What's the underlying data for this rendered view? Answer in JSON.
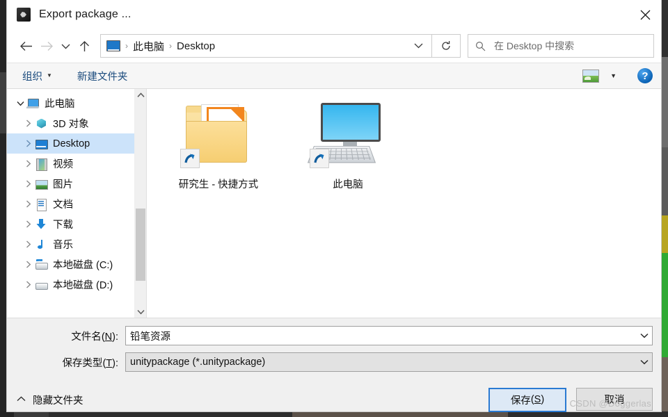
{
  "window": {
    "title": "Export package ...",
    "app_icon": "unity-icon",
    "close_label": "✕"
  },
  "nav": {
    "back_icon": "arrow-left-icon",
    "forward_icon": "arrow-right-icon",
    "recent_icon": "chevron-down-icon",
    "up_icon": "arrow-up-icon",
    "refresh_icon": "refresh-icon",
    "address_icon": "desktop-icon",
    "breadcrumbs": [
      "此电脑",
      "Desktop"
    ],
    "separator": "›",
    "dropdown_icon": "chevron-down-icon"
  },
  "search": {
    "icon": "search-icon",
    "placeholder": "在 Desktop 中搜索"
  },
  "toolbar": {
    "organize_label": "组织",
    "organize_caret": "▼",
    "new_folder_label": "新建文件夹",
    "view_icon": "view-layout-icon",
    "view_caret": "▼",
    "help_label": "?"
  },
  "sidebar": {
    "items": [
      {
        "label": "此电脑",
        "icon": "this-pc-icon",
        "level": 0,
        "expanded": true,
        "selected": false
      },
      {
        "label": "3D 对象",
        "icon": "3d-objects-icon",
        "level": 1,
        "expanded": false,
        "selected": false
      },
      {
        "label": "Desktop",
        "icon": "desktop-icon",
        "level": 1,
        "expanded": false,
        "selected": true
      },
      {
        "label": "视频",
        "icon": "videos-icon",
        "level": 1,
        "expanded": false,
        "selected": false
      },
      {
        "label": "图片",
        "icon": "pictures-icon",
        "level": 1,
        "expanded": false,
        "selected": false
      },
      {
        "label": "文档",
        "icon": "documents-icon",
        "level": 1,
        "expanded": false,
        "selected": false
      },
      {
        "label": "下载",
        "icon": "downloads-icon",
        "level": 1,
        "expanded": false,
        "selected": false
      },
      {
        "label": "音乐",
        "icon": "music-icon",
        "level": 1,
        "expanded": false,
        "selected": false
      },
      {
        "label": "本地磁盘 (C:)",
        "icon": "system-drive-icon",
        "level": 1,
        "expanded": false,
        "selected": false
      },
      {
        "label": "本地磁盘 (D:)",
        "icon": "drive-icon",
        "level": 1,
        "expanded": false,
        "selected": false
      }
    ],
    "scroll_up_icon": "chevron-up-icon",
    "scroll_down_icon": "chevron-down-icon"
  },
  "files": [
    {
      "name": "研究生 - 快捷方式",
      "icon": "pdf-folder-shortcut-icon",
      "badge": "PDF"
    },
    {
      "name": "此电脑",
      "icon": "this-pc-shortcut-icon"
    }
  ],
  "form": {
    "filename_label": "文件名(N):",
    "filename_label_plain": "文件名",
    "filename_accel": "N",
    "filename_value": "铅笔资源",
    "savetype_label": "保存类型(T):",
    "savetype_label_plain": "保存类型",
    "savetype_accel": "T",
    "savetype_value": "unitypackage (*.unitypackage)",
    "caret_icon": "chevron-down-icon"
  },
  "actions": {
    "hide_folders_label": "隐藏文件夹",
    "hide_folders_caret": "∧",
    "save_label": "保存(S)",
    "save_label_plain": "保存",
    "save_accel": "S",
    "cancel_label": "取消"
  },
  "watermark": "CSDN @Doggerlas",
  "colors": {
    "accent": "#2a7ad2",
    "selection": "#cce3fa",
    "toolbar_link": "#1b4b7d",
    "pdf_orange": "#f2861e",
    "folder_yellow": "#f7d98e"
  }
}
